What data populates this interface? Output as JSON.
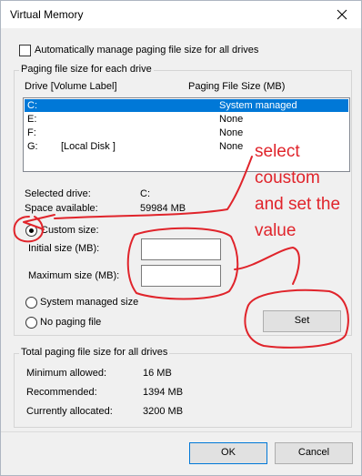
{
  "window": {
    "title": "Virtual Memory",
    "close_icon": "close-icon"
  },
  "auto_manage": {
    "label": "Automatically manage paging file size for all drives",
    "checked": false
  },
  "drives_group": {
    "title": "Paging file size for each drive",
    "headers": {
      "drive": "Drive  [Volume Label]",
      "size": "Paging File Size (MB)"
    },
    "rows": [
      {
        "drive": "C:",
        "label": "",
        "size": "System managed",
        "selected": true
      },
      {
        "drive": "E:",
        "label": "",
        "size": "None",
        "selected": false
      },
      {
        "drive": "F:",
        "label": "",
        "size": "None",
        "selected": false
      },
      {
        "drive": "G:",
        "label": "[Local Disk ]",
        "size": "None",
        "selected": false
      }
    ],
    "selected_drive_label": "Selected drive:",
    "selected_drive_value": "C:",
    "space_available_label": "Space available:",
    "space_available_value": "59984 MB",
    "custom_size_label": "Custom size:",
    "initial_size_label": "Initial size (MB):",
    "initial_size_value": "",
    "maximum_size_label": "Maximum size (MB):",
    "maximum_size_value": "",
    "system_managed_label": "System managed size",
    "no_paging_label": "No paging file",
    "selected_option": "custom",
    "set_button": "Set"
  },
  "totals_group": {
    "title": "Total paging file size for all drives",
    "min_label": "Minimum allowed:",
    "min_value": "16 MB",
    "recommended_label": "Recommended:",
    "recommended_value": "1394 MB",
    "allocated_label": "Currently allocated:",
    "allocated_value": "3200 MB"
  },
  "footer": {
    "ok": "OK",
    "cancel": "Cancel"
  },
  "annotation": {
    "lines": [
      "select",
      "coustom",
      "and set the",
      "value"
    ],
    "color": "#e0242b"
  },
  "colors": {
    "selection": "#0078d7",
    "dialog_bg": "#f0f0f0"
  }
}
